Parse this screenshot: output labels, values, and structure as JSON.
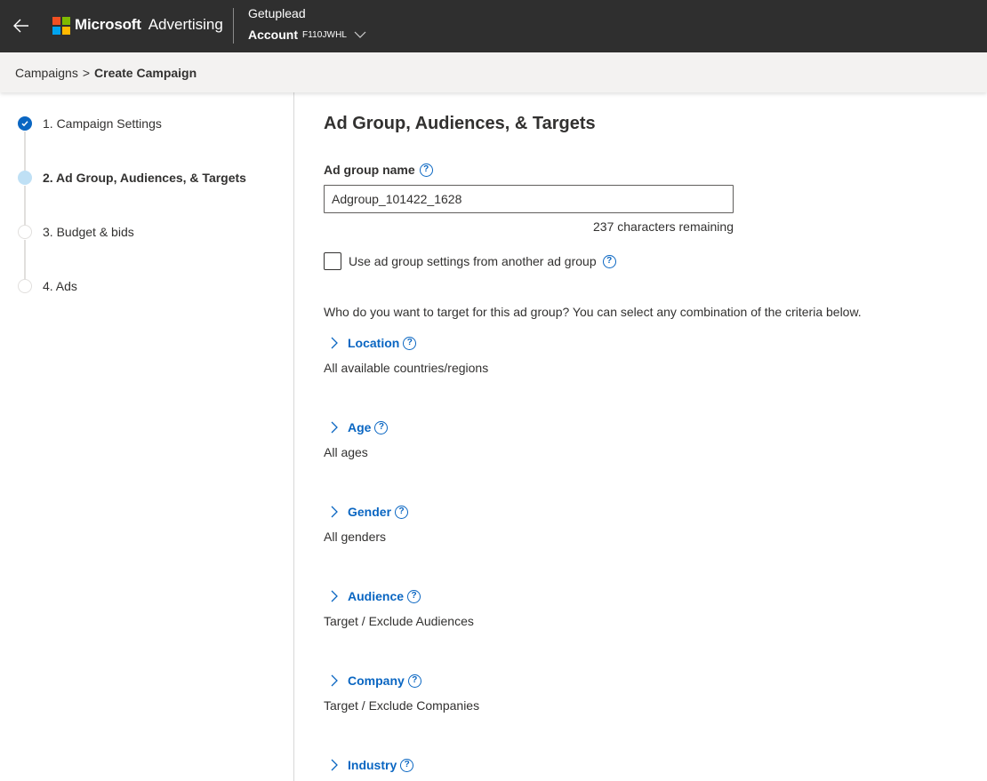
{
  "colors": {
    "topbar_bg": "#2f2f2f",
    "accent_blue": "#0a66c2",
    "breadcrumb_bg": "#f3f2f1",
    "step_current": "#bfe0f5",
    "logo": [
      "#f25022",
      "#7fba00",
      "#00a4ef",
      "#ffb900"
    ]
  },
  "header": {
    "back_icon": "arrow-left-icon",
    "brand_microsoft": "Microsoft",
    "brand_product": "Advertising",
    "account_name": "Getuplead",
    "account_label": "Account",
    "account_id": "F110JWHL",
    "account_chevron_icon": "chevron-down-icon"
  },
  "breadcrumb": {
    "items": [
      "Campaigns",
      "Create Campaign"
    ],
    "separator": ">"
  },
  "steps": [
    {
      "label": "1. Campaign Settings",
      "status": "completed",
      "icon": "check-icon"
    },
    {
      "label": "2. Ad Group, Audiences, & Targets",
      "status": "current"
    },
    {
      "label": "3. Budget & bids",
      "status": "pending"
    },
    {
      "label": "4. Ads",
      "status": "pending"
    }
  ],
  "main": {
    "title": "Ad Group, Audiences, & Targets",
    "ad_group_name": {
      "label": "Ad group name",
      "value": "Adgroup_101422_1628",
      "chars_remaining": "237 characters remaining"
    },
    "copy_settings": {
      "label": "Use ad group settings from another ad group",
      "checked": false
    },
    "target_intro": "Who do you want to target for this ad group? You can select any combination of the criteria below.",
    "criteria": [
      {
        "name": "Location",
        "description": "All available countries/regions"
      },
      {
        "name": "Age",
        "description": "All ages"
      },
      {
        "name": "Gender",
        "description": "All genders"
      },
      {
        "name": "Audience",
        "description": "Target / Exclude Audiences"
      },
      {
        "name": "Company",
        "description": "Target / Exclude Companies"
      },
      {
        "name": "Industry",
        "description": ""
      }
    ],
    "help_glyph": "?"
  }
}
